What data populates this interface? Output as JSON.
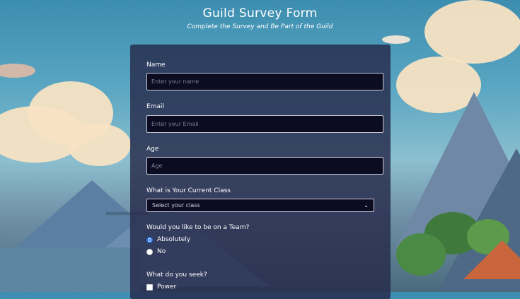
{
  "header": {
    "title": "Guild Survey Form",
    "subtitle": "Complete the Survey and Be Part of the Guild"
  },
  "form": {
    "name": {
      "label": "Name",
      "placeholder": "Enter your name"
    },
    "email": {
      "label": "Email",
      "placeholder": "Enter your Email"
    },
    "age": {
      "label": "Age",
      "placeholder": "Age"
    },
    "class": {
      "label": "What is Your Current Class",
      "selected": "Select your class"
    },
    "team": {
      "label": "Would you like to be on a Team?",
      "options": [
        {
          "label": "Absolutely",
          "checked": true
        },
        {
          "label": "No",
          "checked": false
        }
      ]
    },
    "seek": {
      "label": "What do you seek?",
      "options": [
        {
          "label": "Power",
          "checked": false
        }
      ]
    }
  },
  "colors": {
    "panel": "#262a4a",
    "input_bg": "#0b0b22",
    "radio_accent": "#1f6fe5"
  },
  "icons": {
    "select_arrow": "chevron-down-icon"
  }
}
